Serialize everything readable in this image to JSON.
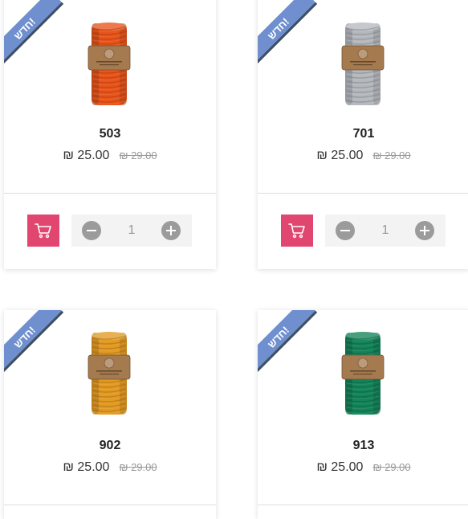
{
  "products": [
    {
      "badge": "חדש!",
      "name": "503",
      "price": "₪ 25.00",
      "old_price": "₪ 29.00",
      "yarn_color": "#e8541a",
      "quantity": "1"
    },
    {
      "badge": "חדש!",
      "name": "701",
      "price": "₪ 25.00",
      "old_price": "₪ 29.00",
      "yarn_color": "#b4b8bd",
      "quantity": "1"
    },
    {
      "badge": "חדש!",
      "name": "902",
      "price": "₪ 25.00",
      "old_price": "₪ 29.00",
      "yarn_color": "#e39a22"
    },
    {
      "badge": "חדש!",
      "name": "913",
      "price": "₪ 25.00",
      "old_price": "₪ 29.00",
      "yarn_color": "#14845a"
    }
  ],
  "colors": {
    "cart_button": "#e0466f",
    "ribbon": "#6f8fcf",
    "label_kraft": "#a57a4f"
  },
  "icons": {
    "cart": "cart-icon",
    "minus": "minus-icon",
    "plus": "plus-icon"
  }
}
